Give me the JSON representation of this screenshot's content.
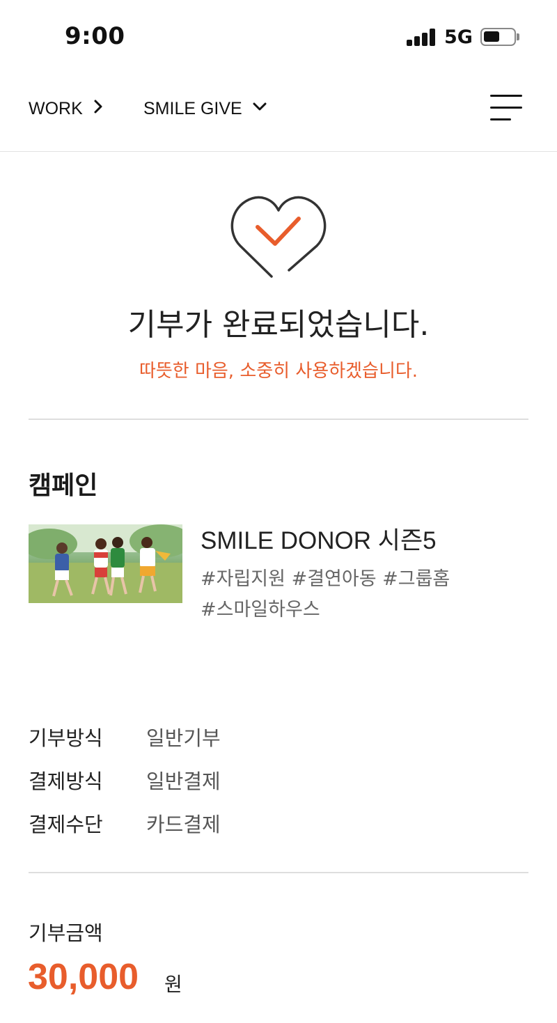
{
  "status_bar": {
    "time": "9:00",
    "network": "5G",
    "battery_level": 0.5
  },
  "nav": {
    "breadcrumb_1": "WORK",
    "breadcrumb_2": "SMILE GIVE",
    "menu_icon": "hamburger-icon"
  },
  "result": {
    "icon": "heart-check-icon",
    "title": "기부가 완료되었습니다.",
    "subtitle": "따뜻한 마음, 소중히 사용하겠습니다."
  },
  "campaign": {
    "section_title": "캠페인",
    "name": "SMILE DONOR 시즌5",
    "tags_line_1": "#자립지원 #결연아동 #그룹홈",
    "tags_line_2": "#스마일하우스"
  },
  "details": [
    {
      "label": "기부방식",
      "value": "일반기부"
    },
    {
      "label": "결제방식",
      "value": "일반결제"
    },
    {
      "label": "결제수단",
      "value": "카드결제"
    }
  ],
  "amount": {
    "label": "기부금액",
    "value": "30,000",
    "unit": "원"
  },
  "colors": {
    "accent": "#e85d2c",
    "text": "#222222",
    "divider": "#dedede"
  }
}
